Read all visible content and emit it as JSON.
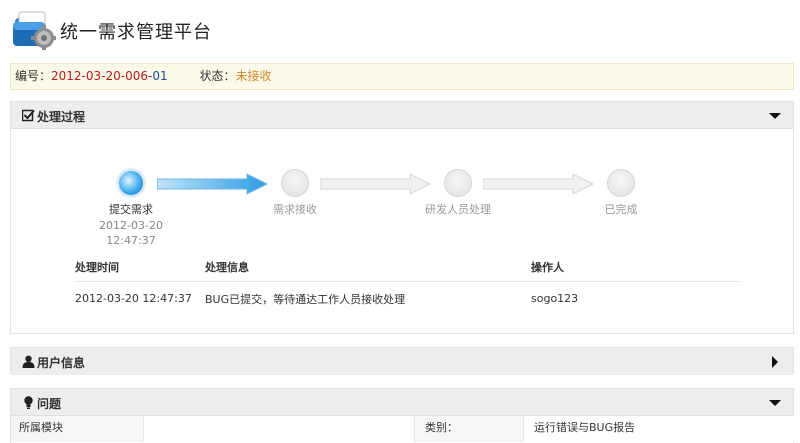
{
  "header": {
    "title": "统一需求管理平台"
  },
  "info": {
    "number_label": "编号：",
    "number_main": "2012-03-20-006-",
    "number_tail": "01",
    "status_label": "状态：",
    "status_value": "未接收"
  },
  "process": {
    "title": "处理过程",
    "steps": [
      {
        "label": "提交需求",
        "date": "2012-03-20",
        "time": "12:47:37"
      },
      {
        "label": "需求接收"
      },
      {
        "label": "研发人员处理"
      },
      {
        "label": "已完成"
      }
    ],
    "log": {
      "headers": [
        "处理时间",
        "处理信息",
        "操作人"
      ],
      "rows": [
        [
          "2012-03-20 12:47:37",
          "BUG已提交，等待通达工作人员接收处理",
          "sogo123"
        ]
      ]
    }
  },
  "user": {
    "title": "用户信息"
  },
  "issue": {
    "title": "问题",
    "module_label": "所属模块",
    "module_value": "",
    "category_label": "类别：",
    "category_value": "运行错误与BUG报告"
  },
  "colors": {
    "accent_blue": "#1b8ad8",
    "number_red": "#b71c1c",
    "status_orange": "#d08a2e"
  },
  "icons": [
    "app-logo-icon",
    "checkbox-icon",
    "user-icon",
    "bulb-icon",
    "triangle-down-icon",
    "triangle-right-icon"
  ]
}
